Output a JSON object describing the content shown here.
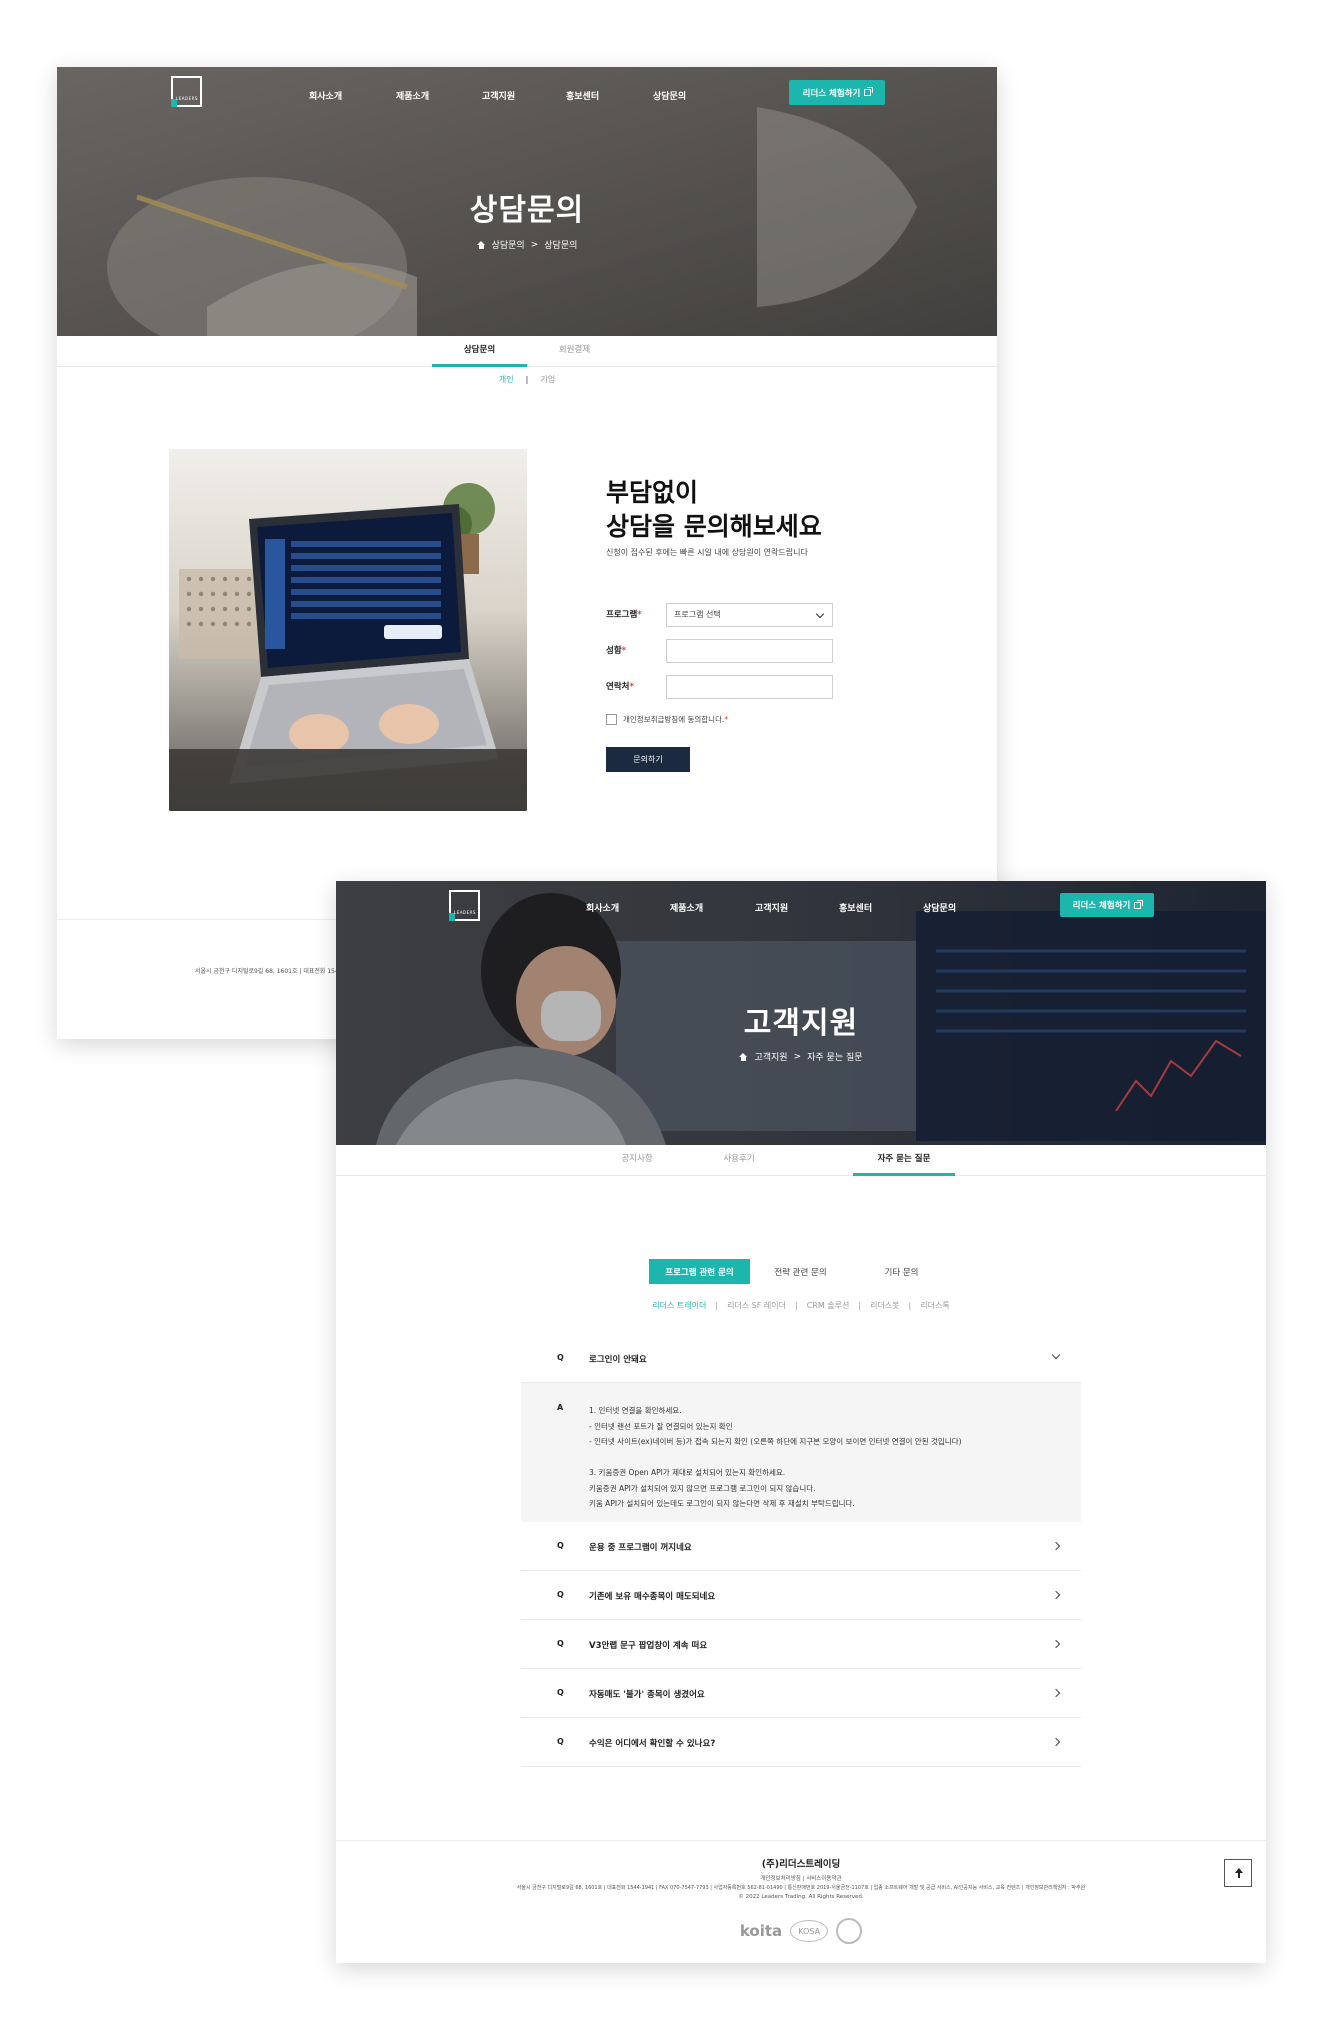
{
  "nav": {
    "items": [
      "회사소개",
      "제품소개",
      "고객지원",
      "홍보센터",
      "상담문의"
    ],
    "cta": "리더스 체험하기"
  },
  "logo": {
    "text": "LEADERS"
  },
  "colors": {
    "accent": "#1db6ad",
    "submit": "#1b2a3e",
    "required": "#e0414a"
  },
  "inquiry_page": {
    "hero_title": "상담문의",
    "breadcrumb": [
      "상담문의",
      "상담문의"
    ],
    "tabs": [
      "상담문의",
      "회원결제"
    ],
    "subtabs": [
      "개인",
      "기업"
    ],
    "form": {
      "heading_line1": "부담없이",
      "heading_line2": "상담을 문의해보세요",
      "subtitle": "신청이 접수된 후에는 빠른 시일 내에 상담원이 연락드립니다",
      "program_label": "프로그램",
      "program_placeholder": "프로그램 선택",
      "name_label": "성함",
      "phone_label": "연락처",
      "required_mark": "*",
      "agree_label": "개인정보취급방침에 동의합니다.",
      "submit": "문의하기"
    },
    "footer_text": "서울시 금천구 디지털로9길 68, 1601호 | 대표전화 1544"
  },
  "support_page": {
    "hero_title": "고객지원",
    "breadcrumb": [
      "고객지원",
      "자주 묻는 질문"
    ],
    "tabs": [
      "공지사항",
      "사용후기",
      "자주 묻는 질문"
    ],
    "categories": [
      "프로그램 관련 문의",
      "전략 관련 문의",
      "기타 문의"
    ],
    "products": [
      "리더스 트레이더",
      "리더스 SF 레이더",
      "CRM 솔루션",
      "리더스봇",
      "리더스톡"
    ],
    "faq": [
      {
        "q_mark": "Q",
        "question": "로그인이 안돼요"
      },
      {
        "q_mark": "Q",
        "question": "운용 중 프로그램이 꺼지네요"
      },
      {
        "q_mark": "Q",
        "question": "기존에 보유 매수종목이 매도되네요"
      },
      {
        "q_mark": "Q",
        "question": "V3안랩 문구 팝업창이 계속 떠요"
      },
      {
        "q_mark": "Q",
        "question": "자동매도 '불가' 종목이 생겼어요"
      },
      {
        "q_mark": "Q",
        "question": "수익은 어디에서 확인할 수 있나요?"
      }
    ],
    "answer": {
      "a_mark": "A",
      "lines": [
        "1. 인터넷 연결을 확인하세요.",
        "- 인터넷 랜선 포트가 잘 연결되어 있는지 확인",
        "- 인터넷 사이트(ex)네이버 등)가 접속 되는지 확인 (오른쪽 하단에 지구본 모양이 보이면 인터넷 연결이 안된 것입니다)",
        "",
        "3. 키움증권 Open API가 제대로 설치되어 있는지 확인하세요.",
        "키움증권 API가 설치되어 있지 않으면 프로그램 로그인이 되지 않습니다.",
        "키움 API가 설치되어 있는데도 로그인이 되지 않는다면 삭제 후 재설치 부탁드립니다."
      ]
    },
    "footer": {
      "company": "(주)리더스트레이딩",
      "links": "개인정보처리방침 | 서비스이용약관",
      "info": "서울시 금천구 디지털로9길 68, 1601호 | 대표전화 1544-1941 | FAX 070-7547-7793 | 사업자등록번호 562-81-01490 | 통신판매번호 2019-서울금천-1107호 | 업종 소프트웨어 개발 및 공급 서비스, AI인공지능 서비스, 교육 컨텐츠 | 개인정보관리책임자 : 박주완",
      "copyright": "© 2022 Leaders Trading. All Rights Reserved.",
      "logos": [
        "koita",
        "KOSA"
      ]
    }
  }
}
